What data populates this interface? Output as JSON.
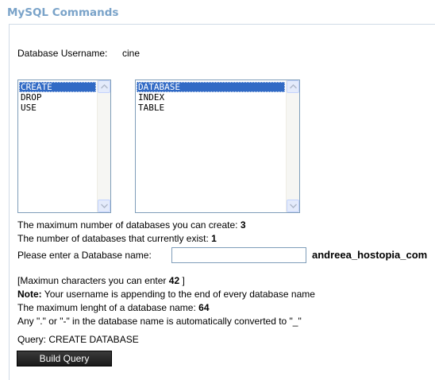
{
  "header": {
    "title": "MySQL Commands"
  },
  "form": {
    "username_label": "Database Username:",
    "username_value": "cine",
    "commands": [
      {
        "label": "CREATE",
        "selected": true
      },
      {
        "label": "DROP",
        "selected": false
      },
      {
        "label": "USE",
        "selected": false
      }
    ],
    "objects": [
      {
        "label": "DATABASE",
        "selected": true
      },
      {
        "label": "INDEX",
        "selected": false
      },
      {
        "label": "TABLE",
        "selected": false
      }
    ],
    "max_db_label": "The maximum number of databases you can create:",
    "max_db_value": "3",
    "current_db_label": "The number of databases that currently exist:",
    "current_db_value": "1",
    "db_name_label": "Please enter a Database name:",
    "db_name_value": "",
    "db_suffix": "andreea_hostopia_com",
    "max_chars_prefix": "[Maximun characters you can enter",
    "max_chars_value": "42",
    "max_chars_suffix": "]",
    "note_label": "Note:",
    "note_text": "Your username is appending to the end of every database name",
    "max_len_label": "The maximum lenght of a database name:",
    "max_len_value": "64",
    "convert_text": "Any \".\" or \"-\" in the database name is automatically converted to \"_\"",
    "query_text": "Query: CREATE DATABASE",
    "build_button": "Build Query"
  }
}
